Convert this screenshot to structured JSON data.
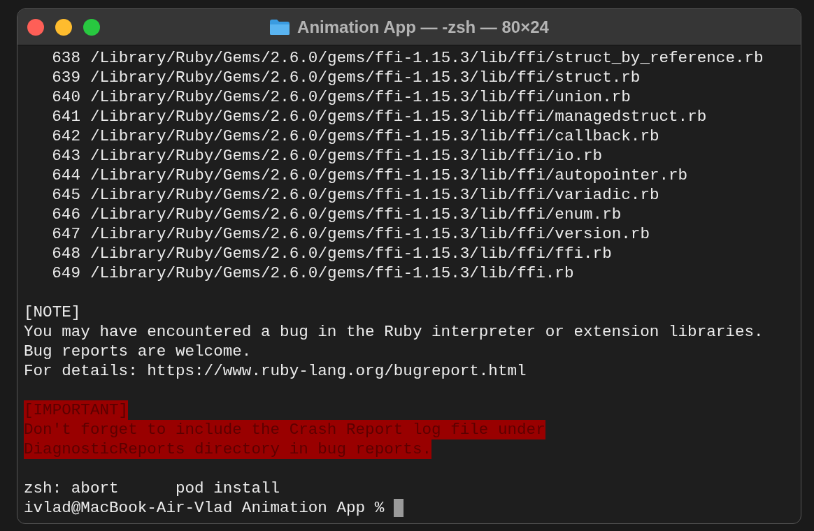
{
  "window": {
    "title": "Animation App — -zsh — 80×24"
  },
  "listing": [
    {
      "number": "638",
      "path": "/Library/Ruby/Gems/2.6.0/gems/ffi-1.15.3/lib/ffi/struct_by_reference.rb"
    },
    {
      "number": "639",
      "path": "/Library/Ruby/Gems/2.6.0/gems/ffi-1.15.3/lib/ffi/struct.rb"
    },
    {
      "number": "640",
      "path": "/Library/Ruby/Gems/2.6.0/gems/ffi-1.15.3/lib/ffi/union.rb"
    },
    {
      "number": "641",
      "path": "/Library/Ruby/Gems/2.6.0/gems/ffi-1.15.3/lib/ffi/managedstruct.rb"
    },
    {
      "number": "642",
      "path": "/Library/Ruby/Gems/2.6.0/gems/ffi-1.15.3/lib/ffi/callback.rb"
    },
    {
      "number": "643",
      "path": "/Library/Ruby/Gems/2.6.0/gems/ffi-1.15.3/lib/ffi/io.rb"
    },
    {
      "number": "644",
      "path": "/Library/Ruby/Gems/2.6.0/gems/ffi-1.15.3/lib/ffi/autopointer.rb"
    },
    {
      "number": "645",
      "path": "/Library/Ruby/Gems/2.6.0/gems/ffi-1.15.3/lib/ffi/variadic.rb"
    },
    {
      "number": "646",
      "path": "/Library/Ruby/Gems/2.6.0/gems/ffi-1.15.3/lib/ffi/enum.rb"
    },
    {
      "number": "647",
      "path": "/Library/Ruby/Gems/2.6.0/gems/ffi-1.15.3/lib/ffi/version.rb"
    },
    {
      "number": "648",
      "path": "/Library/Ruby/Gems/2.6.0/gems/ffi-1.15.3/lib/ffi/ffi.rb"
    },
    {
      "number": "649",
      "path": "/Library/Ruby/Gems/2.6.0/gems/ffi-1.15.3/lib/ffi.rb"
    }
  ],
  "lines": [
    {
      "kind": "blank"
    },
    {
      "kind": "plain",
      "text": "[NOTE]"
    },
    {
      "kind": "plain",
      "text": "You may have encountered a bug in the Ruby interpreter or extension libraries."
    },
    {
      "kind": "plain",
      "text": "Bug reports are welcome."
    },
    {
      "kind": "plain",
      "text": "For details: https://www.ruby-lang.org/bugreport.html"
    },
    {
      "kind": "blank"
    },
    {
      "kind": "alert",
      "text": "[IMPORTANT]"
    },
    {
      "kind": "alert",
      "text": "Don't forget to include the Crash Report log file under"
    },
    {
      "kind": "alert",
      "text": "DiagnosticReports directory in bug reports."
    },
    {
      "kind": "blank"
    },
    {
      "kind": "plain",
      "text": "zsh: abort      pod install"
    }
  ],
  "prompt": {
    "text": "ivlad@MacBook-Air-Vlad Animation App %"
  }
}
